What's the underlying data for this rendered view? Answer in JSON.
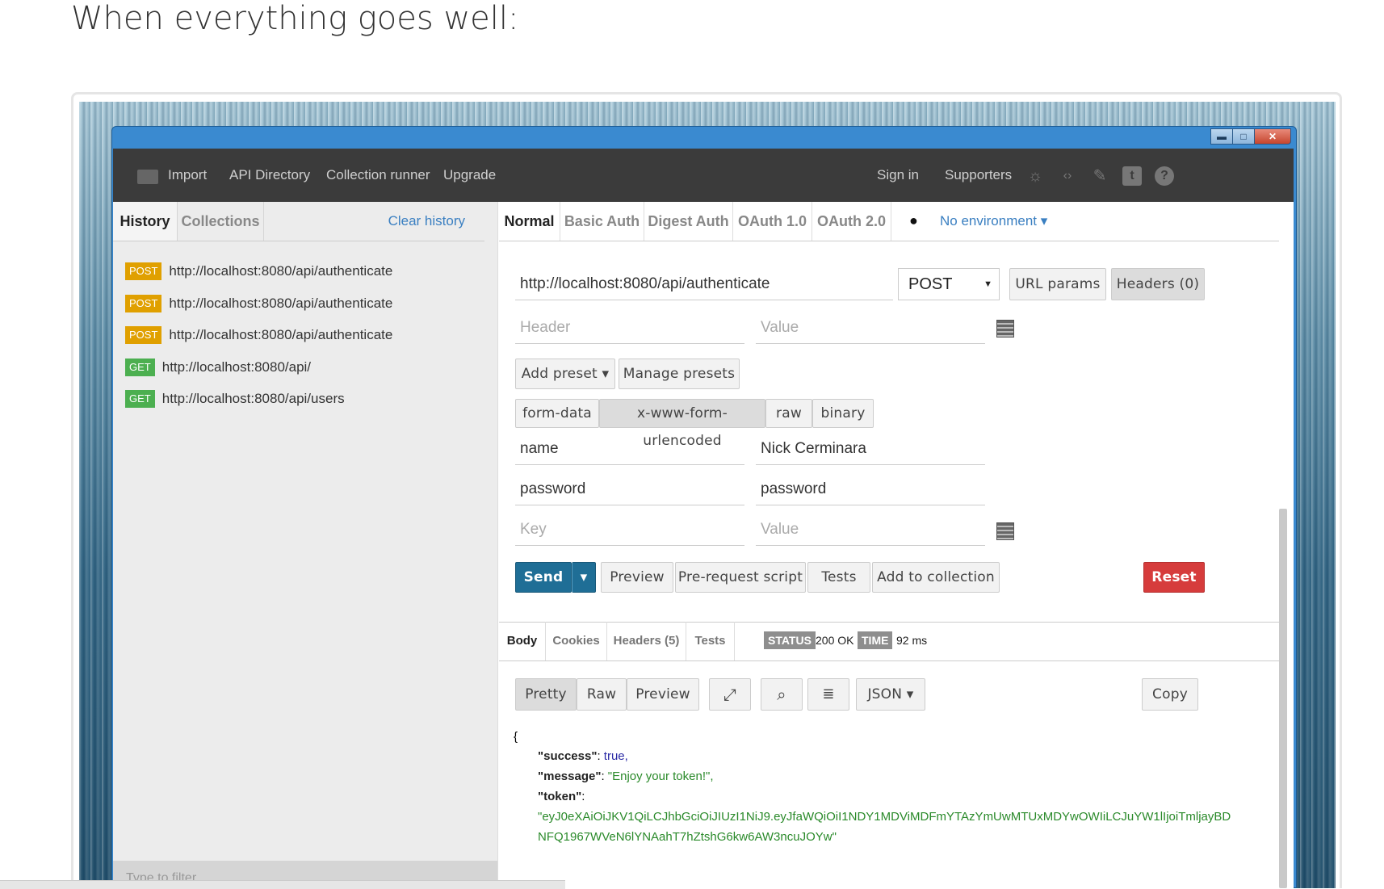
{
  "page_heading": "When everything goes well:",
  "window_buttons": {
    "minimize": "▬",
    "maximize": "□",
    "close": "✕"
  },
  "topbar": {
    "nav": [
      "Import",
      "API Directory",
      "Collection runner",
      "Upgrade"
    ],
    "sign_in": "Sign in",
    "supporters": "Supporters",
    "icons": [
      "bug-icon",
      "code-icon",
      "wrench-icon",
      "twitter-icon",
      "help-icon"
    ]
  },
  "left": {
    "tabs": [
      "History",
      "Collections"
    ],
    "clear_history": "Clear history",
    "history": [
      {
        "method": "POST",
        "url": "http://localhost:8080/api/authenticate"
      },
      {
        "method": "POST",
        "url": "http://localhost:8080/api/authenticate"
      },
      {
        "method": "POST",
        "url": "http://localhost:8080/api/authenticate"
      },
      {
        "method": "GET",
        "url": "http://localhost:8080/api/"
      },
      {
        "method": "GET",
        "url": "http://localhost:8080/api/users"
      }
    ],
    "filter_placeholder": "Type to filter"
  },
  "auth_tabs": [
    "Normal",
    "Basic Auth",
    "Digest Auth",
    "OAuth 1.0",
    "OAuth 2.0"
  ],
  "environment": "No environment",
  "request": {
    "url": "http://localhost:8080/api/authenticate",
    "method": "POST",
    "url_params_label": "URL params",
    "headers_label": "Headers (0)",
    "header_placeholder": "Header",
    "value_placeholder": "Value",
    "add_preset": "Add preset",
    "manage_presets": "Manage presets",
    "body_types": [
      "form-data",
      "x-www-form-urlencoded",
      "raw",
      "binary"
    ],
    "body_type_selected": "x-www-form-urlencoded",
    "params": [
      {
        "key": "name",
        "value": "Nick Cerminara"
      },
      {
        "key": "password",
        "value": "password"
      }
    ],
    "key_placeholder": "Key",
    "value_placeholder2": "Value"
  },
  "actions": {
    "send": "Send",
    "preview": "Preview",
    "pre_request": "Pre-request script",
    "tests": "Tests",
    "add_to_collection": "Add to collection",
    "reset": "Reset"
  },
  "response": {
    "tabs": [
      "Body",
      "Cookies",
      "Headers (5)",
      "Tests"
    ],
    "status_label": "STATUS",
    "status_value": "200 OK",
    "time_label": "TIME",
    "time_value": "92 ms",
    "view_modes": [
      "Pretty",
      "Raw",
      "Preview"
    ],
    "format": "JSON",
    "copy": "Copy",
    "json_open": "{",
    "success_key": "\"success\"",
    "success_value": "true,",
    "message_key": "\"message\"",
    "message_value": "\"Enjoy your token!\",",
    "token_key": "\"token\"",
    "token_line1": "\"eyJ0eXAiOiJKV1QiLCJhbGciOiJIUzI1NiJ9.eyJfaWQiOiI1NDY1MDViMDFmYTAzYmUwMTUxMDYwOWIiLCJuYW1lIjoiTmljayBD",
    "token_line2": "NFQ1967WVeN6lYNAahT7hZtshG6kw6AW3ncuJOYw\""
  }
}
